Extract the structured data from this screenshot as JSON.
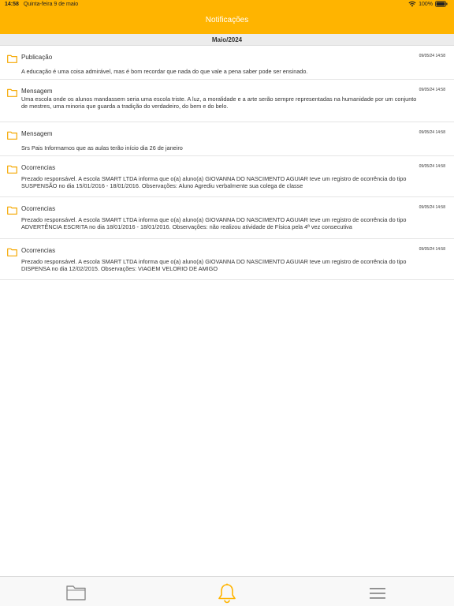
{
  "status_bar": {
    "time": "14:58",
    "date": "Quinta-feira 9 de maio",
    "battery": "100%"
  },
  "nav": {
    "title": "Notificações"
  },
  "section": {
    "title": "Maio/2024"
  },
  "notifications": [
    {
      "category": "Publicação",
      "date": "09/05/24 14:58",
      "text": "A educação é uma coisa admirável, mas é bom recordar que nada do que vale a pena saber pode ser ensinado."
    },
    {
      "category": "Mensagem",
      "date": "09/05/24 14:58",
      "text": "Uma escola onde os alunos mandassem seria uma escola triste. A luz, a moralidade e a arte serão sempre representadas na humanidade por um conjunto\nde mestres, uma minoria que guarda a tradição do verdadeiro, do bem e do belo."
    },
    {
      "category": "Mensagem",
      "date": "09/05/24 14:58",
      "text": "Srs Pais Informamos que as aulas terão início dia 26 de janeiro"
    },
    {
      "category": "Ocorrencias",
      "date": "09/05/24 14:58",
      "text": "Prezado responsável. A escola SMART LTDA informa que o(a) aluno(a) GIOVANNA DO NASCIMENTO AGUIAR teve um registro de ocorrência do tipo\nSUSPENSÃO no dia 15/01/2016 - 18/01/2016. Observações: Aluno Agrediu verbalmente sua colega de classe"
    },
    {
      "category": "Ocorrencias",
      "date": "09/05/24 14:58",
      "text": "Prezado responsável. A escola SMART LTDA informa que o(a) aluno(a) GIOVANNA DO NASCIMENTO AGUIAR teve um registro de ocorrência do tipo\nADVERTÊNCIA ESCRITA no dia 18/01/2016 - 18/01/2016. Observações: não realizou atividade de Física pela 4ª vez consecutiva"
    },
    {
      "category": "Ocorrencias",
      "date": "09/05/24 14:58",
      "text": "Prezado responsável. A escola SMART LTDA informa que o(a) aluno(a) GIOVANNA DO NASCIMENTO AGUIAR teve um registro de ocorrência do tipo\nDISPENSA no dia 12/02/2015. Observações: VIAGEM VELORIO DE AMIGO"
    }
  ],
  "tabbar": {
    "items": [
      {
        "icon": "folder-icon"
      },
      {
        "icon": "bell-icon"
      },
      {
        "icon": "menu-icon"
      }
    ]
  },
  "colors": {
    "accent": "#ffb400",
    "folder_stroke": "#f5a800",
    "tab_inactive": "#8a8a8a"
  }
}
